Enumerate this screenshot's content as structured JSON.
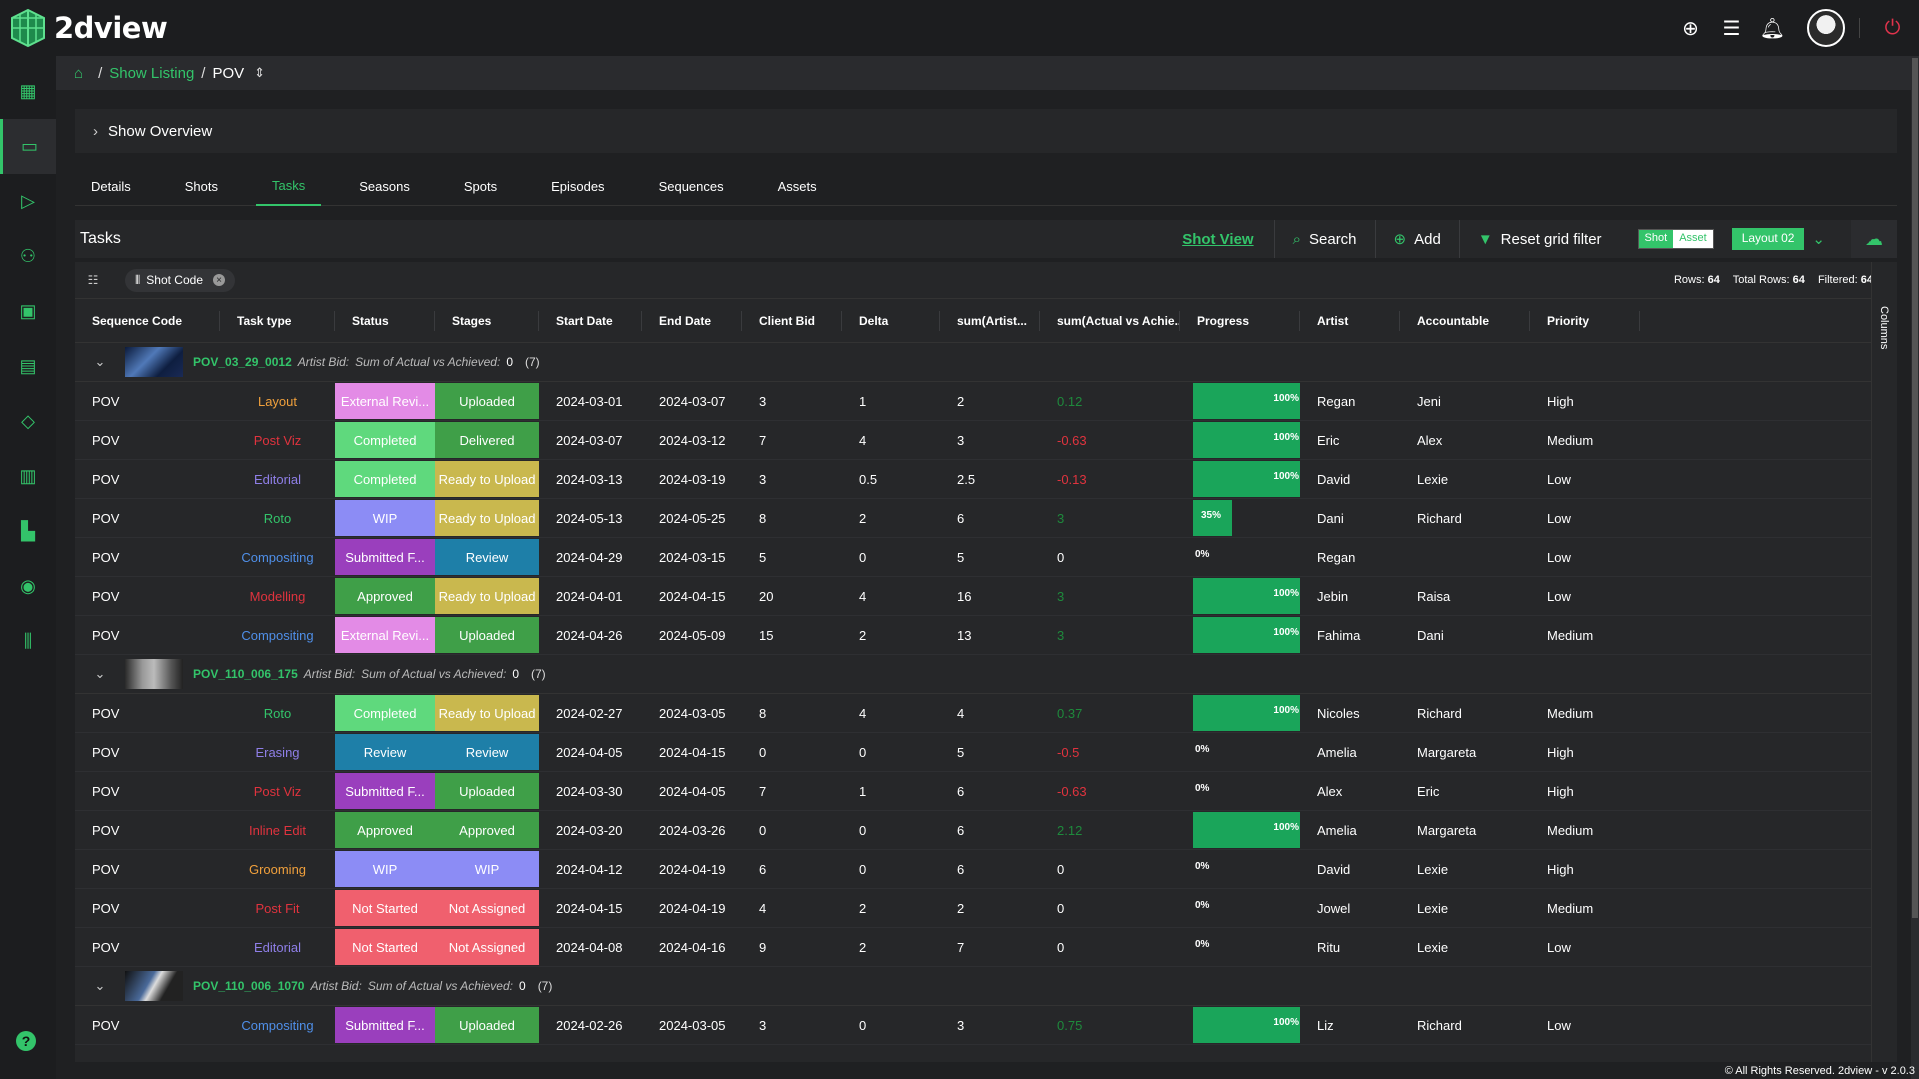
{
  "app": {
    "name": "2dview"
  },
  "breadcrumb": {
    "link": "Show Listing",
    "current": "POV",
    "separator": "/"
  },
  "overview": {
    "title": "Show Overview"
  },
  "tabs": [
    {
      "label": "Details",
      "active": false
    },
    {
      "label": "Shots",
      "active": false
    },
    {
      "label": "Tasks",
      "active": true
    },
    {
      "label": "Seasons",
      "active": false
    },
    {
      "label": "Spots",
      "active": false
    },
    {
      "label": "Episodes",
      "active": false
    },
    {
      "label": "Sequences",
      "active": false
    },
    {
      "label": "Assets",
      "active": false
    }
  ],
  "toolbar": {
    "title": "Tasks",
    "shot_view": "Shot View",
    "search": "Search",
    "add": "Add",
    "reset": "Reset grid filter",
    "toggle_shot": "Shot",
    "toggle_asset": "Asset",
    "layout": "Layout 02"
  },
  "filter": {
    "chip": "Shot Code",
    "rows_label": "Rows:",
    "rows": "64",
    "total_label": "Total Rows:",
    "total": "64",
    "filtered_label": "Filtered:",
    "filtered": "64"
  },
  "columns_label": "Columns",
  "headers": [
    "Sequence Code",
    "Task type",
    "Status",
    "Stages",
    "Start Date",
    "End Date",
    "Client Bid",
    "Delta",
    "sum(Artist...",
    "sum(Actual vs Achie...",
    "Progress",
    "Artist",
    "Accountable",
    "Priority"
  ],
  "colors": {
    "accent": "#33c46a"
  },
  "groups": [
    {
      "code": "POV_03_29_0012",
      "meta": "Artist Bid:",
      "meta2": "Sum of Actual vs Achieved:",
      "value": "0",
      "count": "(7)",
      "rows": [
        {
          "seq": "POV",
          "task": "Layout",
          "task_color": "#f0a03c",
          "status": "External Revi...",
          "status_bg": "#e38be6",
          "stage": "Uploaded",
          "stage_bg": "#3f9f48",
          "start": "2024-03-01",
          "end": "2024-03-07",
          "bid": "3",
          "delta": "1",
          "sum": "2",
          "ava": "0.12",
          "ava_color": "#1e8a3c",
          "progress": 100,
          "artist": "Regan",
          "acc": "Jeni",
          "priority": "High"
        },
        {
          "seq": "POV",
          "task": "Post Viz",
          "task_color": "#e0333e",
          "status": "Completed",
          "status_bg": "#5fd97d",
          "stage": "Delivered",
          "stage_bg": "#3f9f48",
          "start": "2024-03-07",
          "end": "2024-03-12",
          "bid": "7",
          "delta": "4",
          "sum": "3",
          "ava": "-0.63",
          "ava_color": "#e0333e",
          "progress": 100,
          "artist": "Eric",
          "acc": "Alex",
          "priority": "Medium"
        },
        {
          "seq": "POV",
          "task": "Editorial",
          "task_color": "#8f7fe8",
          "status": "Completed",
          "status_bg": "#5fd97d",
          "stage": "Ready to Upload",
          "stage_bg": "#c9b84e",
          "start": "2024-03-13",
          "end": "2024-03-19",
          "bid": "3",
          "delta": "0.5",
          "sum": "2.5",
          "ava": "-0.13",
          "ava_color": "#e0333e",
          "progress": 100,
          "artist": "David",
          "acc": "Lexie",
          "priority": "Low"
        },
        {
          "seq": "POV",
          "task": "Roto",
          "task_color": "#33c46a",
          "status": "WIP",
          "status_bg": "#8c8cf5",
          "stage": "Ready to Upload",
          "stage_bg": "#c9b84e",
          "start": "2024-05-13",
          "end": "2024-05-25",
          "bid": "8",
          "delta": "2",
          "sum": "6",
          "ava": "3",
          "ava_color": "#1e8a3c",
          "progress": 35,
          "artist": "Dani",
          "acc": "Richard",
          "priority": "Low"
        },
        {
          "seq": "POV",
          "task": "Compositing",
          "task_color": "#4f8fe8",
          "status": "Submitted F...",
          "status_bg": "#9a3fbd",
          "stage": "Review",
          "stage_bg": "#1e7fa8",
          "start": "2024-04-29",
          "end": "2024-03-15",
          "bid": "5",
          "delta": "0",
          "sum": "5",
          "ava": "0",
          "ava_color": "#ffffff",
          "progress": 0,
          "artist": "Regan",
          "acc": "",
          "priority": "Low"
        },
        {
          "seq": "POV",
          "task": "Modelling",
          "task_color": "#e0333e",
          "status": "Approved",
          "status_bg": "#3f9f48",
          "stage": "Ready to Upload",
          "stage_bg": "#c9b84e",
          "start": "2024-04-01",
          "end": "2024-04-15",
          "bid": "20",
          "delta": "4",
          "sum": "16",
          "ava": "3",
          "ava_color": "#1e8a3c",
          "progress": 100,
          "artist": "Jebin",
          "acc": "Raisa",
          "priority": "Low"
        },
        {
          "seq": "POV",
          "task": "Compositing",
          "task_color": "#4f8fe8",
          "status": "External Revi...",
          "status_bg": "#e38be6",
          "stage": "Uploaded",
          "stage_bg": "#3f9f48",
          "start": "2024-04-26",
          "end": "2024-05-09",
          "bid": "15",
          "delta": "2",
          "sum": "13",
          "ava": "3",
          "ava_color": "#1e8a3c",
          "progress": 100,
          "artist": "Fahima",
          "acc": "Dani",
          "priority": "Medium"
        }
      ]
    },
    {
      "code": "POV_110_006_175",
      "meta": "Artist Bid:",
      "meta2": "Sum of Actual vs Achieved:",
      "value": "0",
      "count": "(7)",
      "rows": [
        {
          "seq": "POV",
          "task": "Roto",
          "task_color": "#33c46a",
          "status": "Completed",
          "status_bg": "#5fd97d",
          "stage": "Ready to Upload",
          "stage_bg": "#c9b84e",
          "start": "2024-02-27",
          "end": "2024-03-05",
          "bid": "8",
          "delta": "4",
          "sum": "4",
          "ava": "0.37",
          "ava_color": "#1e8a3c",
          "progress": 100,
          "artist": "Nicoles",
          "acc": "Richard",
          "priority": "Medium"
        },
        {
          "seq": "POV",
          "task": "Erasing",
          "task_color": "#8f7fe8",
          "status": "Review",
          "status_bg": "#1e7fa8",
          "stage": "Review",
          "stage_bg": "#1e7fa8",
          "start": "2024-04-05",
          "end": "2024-04-15",
          "bid": "0",
          "delta": "0",
          "sum": "5",
          "ava": "-0.5",
          "ava_color": "#e0333e",
          "progress": 0,
          "artist": "Amelia",
          "acc": "Margareta",
          "priority": "High"
        },
        {
          "seq": "POV",
          "task": "Post Viz",
          "task_color": "#e0333e",
          "status": "Submitted F...",
          "status_bg": "#9a3fbd",
          "stage": "Uploaded",
          "stage_bg": "#3f9f48",
          "start": "2024-03-30",
          "end": "2024-04-05",
          "bid": "7",
          "delta": "1",
          "sum": "6",
          "ava": "-0.63",
          "ava_color": "#e0333e",
          "progress": 0,
          "artist": "Alex",
          "acc": "Eric",
          "priority": "High"
        },
        {
          "seq": "POV",
          "task": "Inline Edit",
          "task_color": "#e0333e",
          "status": "Approved",
          "status_bg": "#3f9f48",
          "stage": "Approved",
          "stage_bg": "#3f9f48",
          "start": "2024-03-20",
          "end": "2024-03-26",
          "bid": "0",
          "delta": "0",
          "sum": "6",
          "ava": "2.12",
          "ava_color": "#1e8a3c",
          "progress": 100,
          "artist": "Amelia",
          "acc": "Margareta",
          "priority": "Medium"
        },
        {
          "seq": "POV",
          "task": "Grooming",
          "task_color": "#f0a03c",
          "status": "WIP",
          "status_bg": "#8c8cf5",
          "stage": "WIP",
          "stage_bg": "#8c8cf5",
          "start": "2024-04-12",
          "end": "2024-04-19",
          "bid": "6",
          "delta": "0",
          "sum": "6",
          "ava": "0",
          "ava_color": "#ffffff",
          "progress": 0,
          "artist": "David",
          "acc": "Lexie",
          "priority": "High"
        },
        {
          "seq": "POV",
          "task": "Post Fit",
          "task_color": "#e0333e",
          "status": "Not Started",
          "status_bg": "#f0606e",
          "stage": "Not Assigned",
          "stage_bg": "#f0606e",
          "start": "2024-04-15",
          "end": "2024-04-19",
          "bid": "4",
          "delta": "2",
          "sum": "2",
          "ava": "0",
          "ava_color": "#ffffff",
          "progress": 0,
          "artist": "Jowel",
          "acc": "Lexie",
          "priority": "Medium"
        },
        {
          "seq": "POV",
          "task": "Editorial",
          "task_color": "#8f7fe8",
          "status": "Not Started",
          "status_bg": "#f0606e",
          "stage": "Not Assigned",
          "stage_bg": "#f0606e",
          "start": "2024-04-08",
          "end": "2024-04-16",
          "bid": "9",
          "delta": "2",
          "sum": "7",
          "ava": "0",
          "ava_color": "#ffffff",
          "progress": 0,
          "artist": "Ritu",
          "acc": "Lexie",
          "priority": "Low"
        }
      ]
    },
    {
      "code": "POV_110_006_1070",
      "meta": "Artist Bid:",
      "meta2": "Sum of Actual vs Achieved:",
      "value": "0",
      "count": "(7)",
      "rows": [
        {
          "seq": "POV",
          "task": "Compositing",
          "task_color": "#4f8fe8",
          "status": "Submitted F...",
          "status_bg": "#9a3fbd",
          "stage": "Uploaded",
          "stage_bg": "#3f9f48",
          "start": "2024-02-26",
          "end": "2024-03-05",
          "bid": "3",
          "delta": "0",
          "sum": "3",
          "ava": "0.75",
          "ava_color": "#1e8a3c",
          "progress": 100,
          "artist": "Liz",
          "acc": "Richard",
          "priority": "Low"
        }
      ]
    }
  ],
  "footer": "© All Rights Reserved. 2dview - v 2.0.3"
}
